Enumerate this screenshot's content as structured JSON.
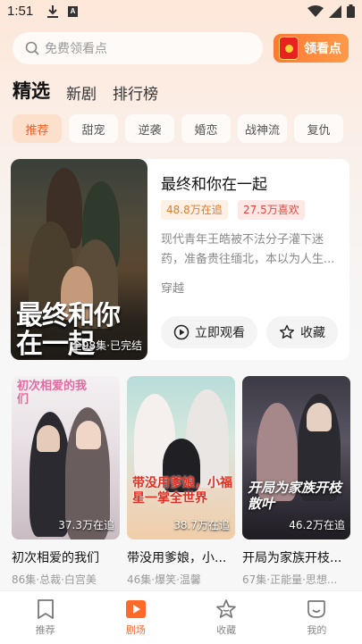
{
  "status": {
    "time": "1:51"
  },
  "search": {
    "placeholder": "免费领看点"
  },
  "promo": {
    "label": "领看点"
  },
  "main_tabs": [
    {
      "label": "精选",
      "active": true
    },
    {
      "label": "新剧",
      "active": false
    },
    {
      "label": "排行榜",
      "active": false
    }
  ],
  "chips": [
    {
      "label": "推荐",
      "active": true
    },
    {
      "label": "甜宠"
    },
    {
      "label": "逆袭"
    },
    {
      "label": "婚恋"
    },
    {
      "label": "战神流"
    },
    {
      "label": "复仇"
    }
  ],
  "featured": {
    "title": "最终和你在一起",
    "poster_title": "最终和你在一起",
    "episodes": "全98集·已完结",
    "watching": "48.8万在追",
    "likes": "27.5万喜欢",
    "description": "现代青年王皓被不法分子灌下迷药，准备贵往缅北，本以为人生...",
    "genre": "穿越",
    "play_label": "立即观看",
    "fav_label": "收藏"
  },
  "dramas": [
    {
      "title": "初次相爱的我们",
      "poster_title": "初次相爱的我们",
      "count": "37.3万在追",
      "meta": "86集·总裁·白宫美"
    },
    {
      "title": "带没用爹娘，小...",
      "poster_title": "带没用爹娘，小福星一掌全世界",
      "count": "38.7万在追",
      "meta": "46集·爆笑·温馨"
    },
    {
      "title": "开局为家族开枝...",
      "poster_title": "开局为家族开枝散叶",
      "count": "46.2万在追",
      "meta": "67集·正能量·思想..."
    }
  ],
  "bottom_nav": [
    {
      "label": "推荐",
      "icon": "bookmark-icon",
      "active": false
    },
    {
      "label": "剧场",
      "icon": "play-screen-icon",
      "active": true
    },
    {
      "label": "收藏",
      "icon": "star-icon",
      "active": false
    },
    {
      "label": "我的",
      "icon": "smile-icon",
      "active": false
    }
  ],
  "colors": {
    "accent": "#ff6a2a",
    "tag_orange": "#e27b2c",
    "tag_red": "#e6463a"
  }
}
